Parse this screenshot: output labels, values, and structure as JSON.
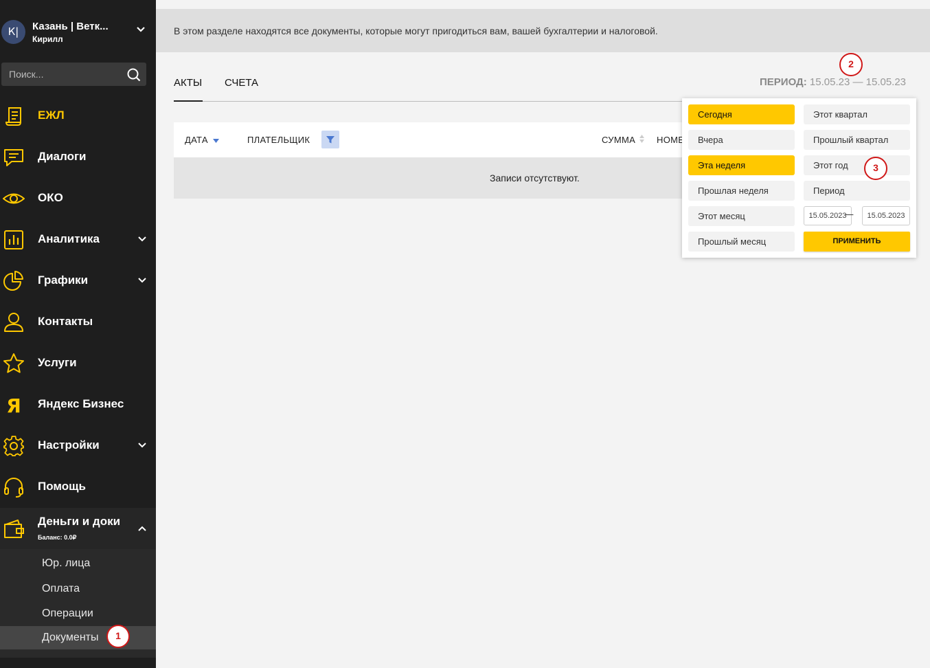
{
  "account": {
    "avatar_initials": "К|",
    "name": "Казань | Ветк...",
    "user": "Кирилл"
  },
  "search": {
    "placeholder": "Поиск..."
  },
  "nav": [
    {
      "label": "ЕЖЛ",
      "icon": "journal-icon",
      "active": true
    },
    {
      "label": "Диалоги",
      "icon": "chat-icon"
    },
    {
      "label": "ОКО",
      "icon": "eye-icon"
    },
    {
      "label": "Аналитика",
      "icon": "analytics-icon",
      "expandable": true
    },
    {
      "label": "Графики",
      "icon": "pie-chart-icon",
      "expandable": true
    },
    {
      "label": "Контакты",
      "icon": "person-icon"
    },
    {
      "label": "Услуги",
      "icon": "star-icon"
    },
    {
      "label": "Яндекс Бизнес",
      "icon": "yandex-icon"
    },
    {
      "label": "Настройки",
      "icon": "gear-icon",
      "expandable": true
    },
    {
      "label": "Помощь",
      "icon": "headset-icon"
    }
  ],
  "money": {
    "label": "Деньги и доки",
    "balance": "Баланс: 0.0₽",
    "sub_items": [
      "Юр. лица",
      "Оплата",
      "Операции",
      "Документы"
    ],
    "current": "Документы"
  },
  "info_text": "В этом разделе находятся все документы, которые могут пригодиться вам, вашей бухгалтерии и налоговой.",
  "tabs": [
    {
      "label": "АКТЫ",
      "active": true
    },
    {
      "label": "СЧЕТА",
      "active": false
    }
  ],
  "period": {
    "label": "ПЕРИОД:",
    "value": "15.05.23 — 15.05.23"
  },
  "table": {
    "columns": [
      "ДАТА",
      "ПЛАТЕЛЬЩИК",
      "СУММА",
      "НОМЕ"
    ],
    "empty_text": "Записи отсутствуют."
  },
  "dropdown": {
    "left_options": [
      "Сегодня",
      "Вчера",
      "Эта неделя",
      "Прошлая неделя",
      "Этот месяц",
      "Прошлый месяц"
    ],
    "right_options": [
      "Этот квартал",
      "Прошлый квартал",
      "Этот год",
      "Период"
    ],
    "selected": [
      "Сегодня",
      "Эта неделя"
    ],
    "date_from": "15.05.2023",
    "date_to": "15.05.2023",
    "date_separator": "—",
    "apply_label": "ПРИМЕНИТЬ"
  },
  "markers": [
    "1",
    "2",
    "3"
  ],
  "colors": {
    "accent": "#ffc800",
    "sidebar": "#1e1e1e",
    "marker": "#d01818",
    "filter": "#4a78d0"
  }
}
